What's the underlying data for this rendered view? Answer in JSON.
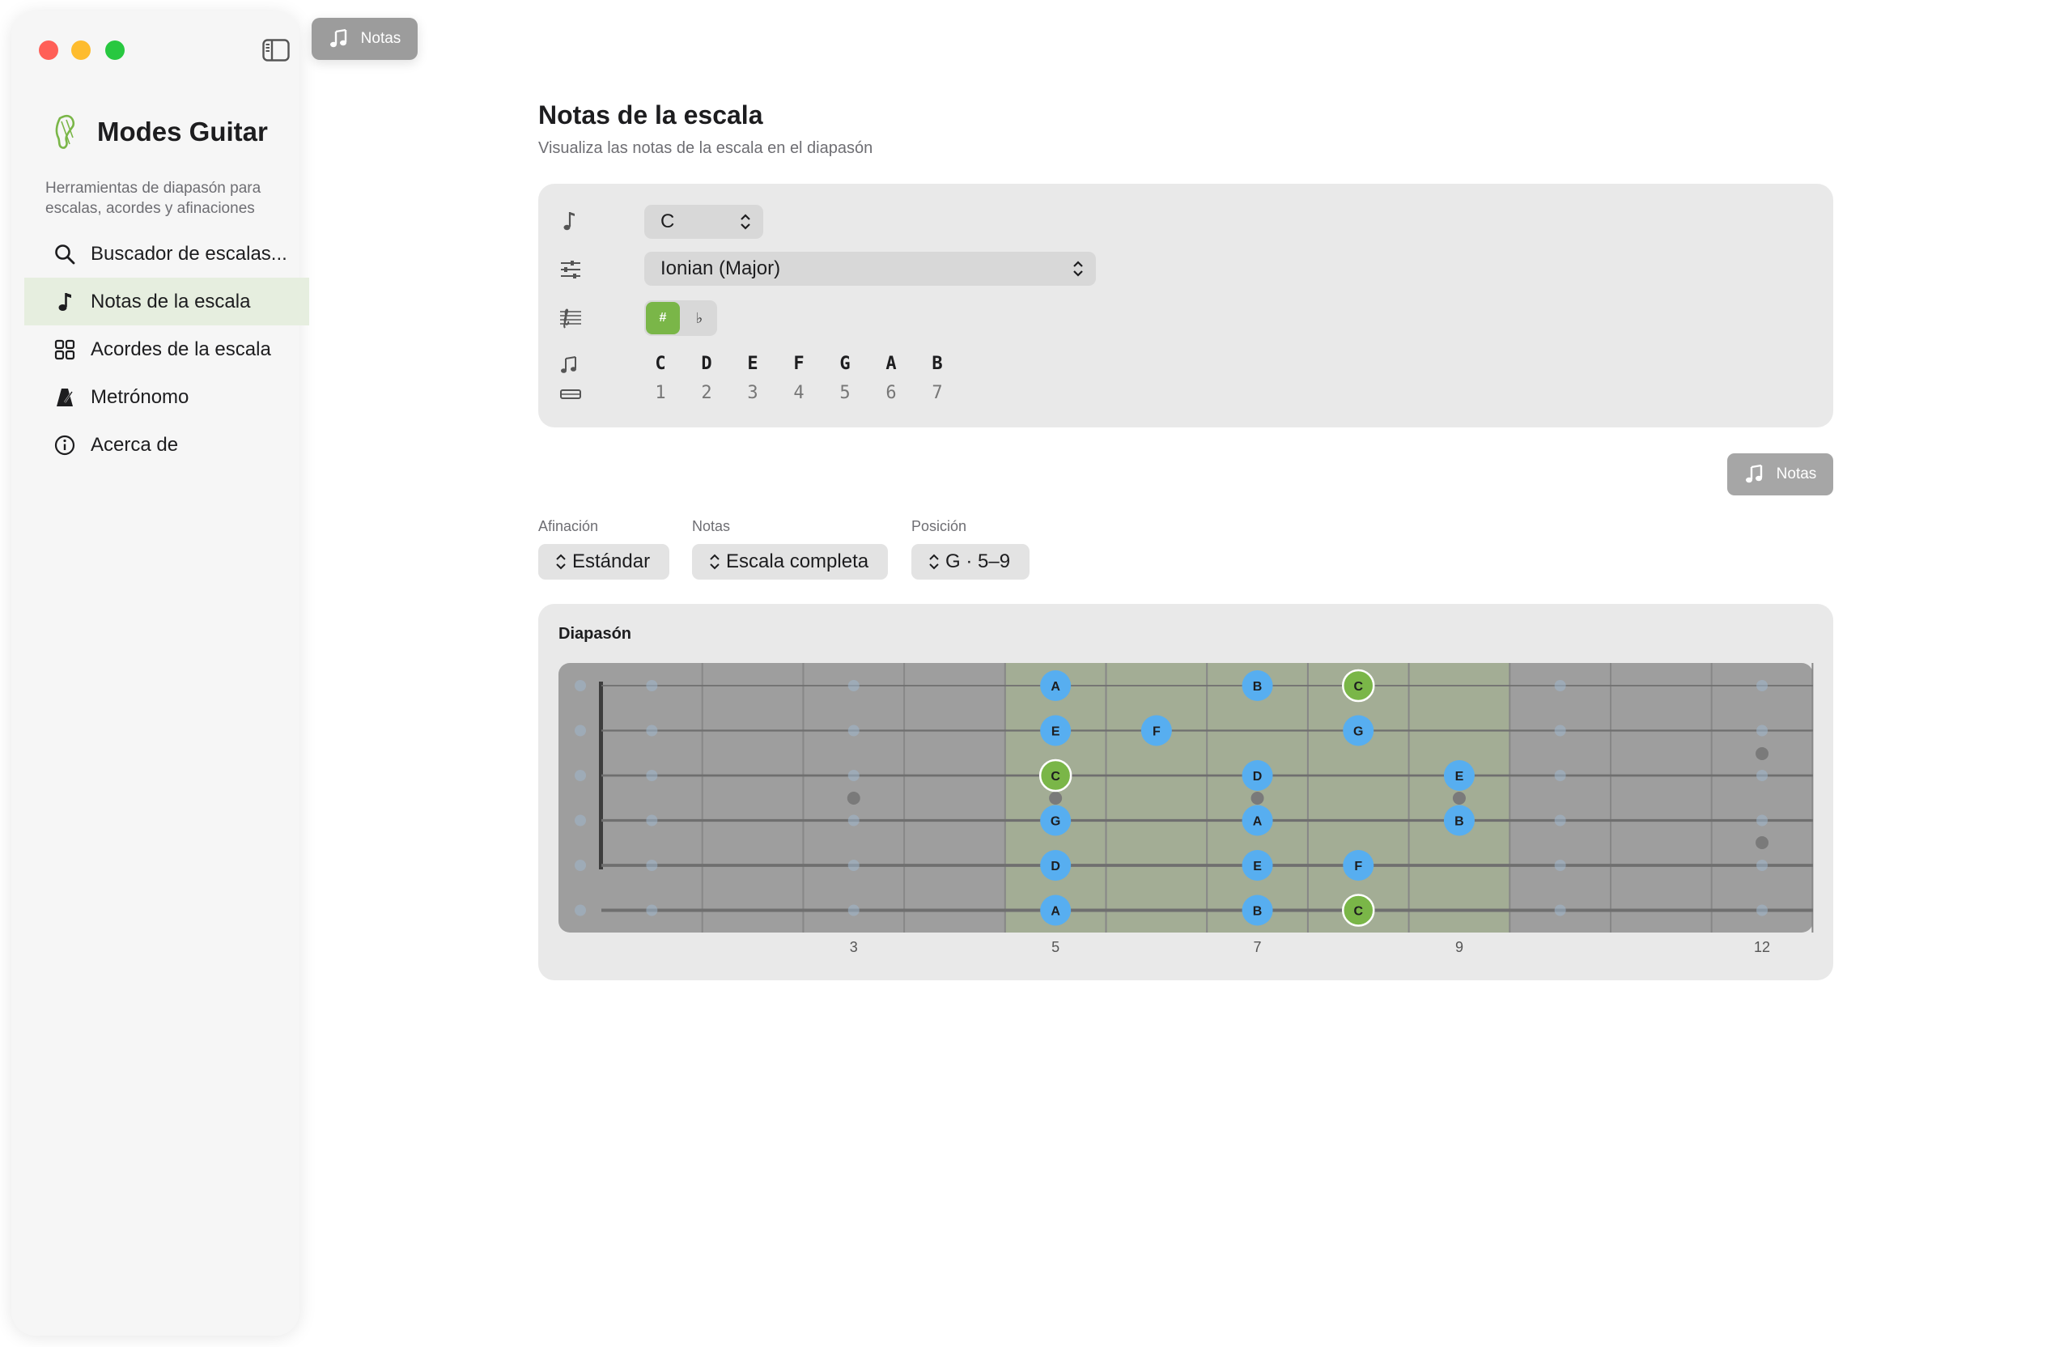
{
  "window": {
    "titlebar_button": {
      "label": "Notas",
      "icon": "music-notes-icon"
    }
  },
  "sidebar": {
    "app_name": "Modes Guitar",
    "tagline": "Herramientas de diapasón para escalas, acordes y afinaciones",
    "items": [
      {
        "label": "Buscador de escalas...",
        "icon": "search-icon",
        "active": false
      },
      {
        "label": "Notas de la escala",
        "icon": "music-note-icon",
        "active": true
      },
      {
        "label": "Acordes de la escala",
        "icon": "grid-icon",
        "active": false
      },
      {
        "label": "Metrónomo",
        "icon": "metronome-icon",
        "active": false
      },
      {
        "label": "Acerca de",
        "icon": "info-icon",
        "active": false
      }
    ]
  },
  "main": {
    "title": "Notas de la escala",
    "subtitle": "Visualiza las notas de la escala en el diapasón",
    "controls": {
      "root": "C",
      "mode": "Ionian (Major)",
      "accidentals": {
        "sharp": "#",
        "flat": "♭",
        "selected": "sharp"
      },
      "scale_notes": [
        "C",
        "D",
        "E",
        "F",
        "G",
        "A",
        "B"
      ],
      "degrees": [
        "1",
        "2",
        "3",
        "4",
        "5",
        "6",
        "7"
      ]
    },
    "notas_button": "Notas",
    "filters": [
      {
        "label": "Afinación",
        "value": "Estándar"
      },
      {
        "label": "Notas",
        "value": "Escala completa"
      },
      {
        "label": "Posición",
        "value": "G · 5–9"
      }
    ],
    "fretboard": {
      "title": "Diapasón",
      "fret_labels": [
        {
          "fret": 3,
          "label": "3"
        },
        {
          "fret": 5,
          "label": "5"
        },
        {
          "fret": 7,
          "label": "7"
        },
        {
          "fret": 9,
          "label": "9"
        },
        {
          "fret": 12,
          "label": "12"
        }
      ],
      "position_range": [
        5,
        9
      ],
      "colors": {
        "board": "#9e9e9e",
        "highlight": "#a3ad95",
        "scale_note": "#57aef0",
        "root_note": "#7ab648"
      },
      "notes": [
        {
          "string": 1,
          "fret": 5,
          "note": "A",
          "root": false
        },
        {
          "string": 1,
          "fret": 7,
          "note": "B",
          "root": false
        },
        {
          "string": 1,
          "fret": 8,
          "note": "C",
          "root": true
        },
        {
          "string": 2,
          "fret": 5,
          "note": "E",
          "root": false
        },
        {
          "string": 2,
          "fret": 6,
          "note": "F",
          "root": false
        },
        {
          "string": 2,
          "fret": 8,
          "note": "G",
          "root": false
        },
        {
          "string": 3,
          "fret": 5,
          "note": "C",
          "root": true
        },
        {
          "string": 3,
          "fret": 7,
          "note": "D",
          "root": false
        },
        {
          "string": 3,
          "fret": 9,
          "note": "E",
          "root": false
        },
        {
          "string": 4,
          "fret": 5,
          "note": "G",
          "root": false
        },
        {
          "string": 4,
          "fret": 7,
          "note": "A",
          "root": false
        },
        {
          "string": 4,
          "fret": 9,
          "note": "B",
          "root": false
        },
        {
          "string": 5,
          "fret": 5,
          "note": "D",
          "root": false
        },
        {
          "string": 5,
          "fret": 7,
          "note": "E",
          "root": false
        },
        {
          "string": 5,
          "fret": 8,
          "note": "F",
          "root": false
        },
        {
          "string": 6,
          "fret": 5,
          "note": "A",
          "root": false
        },
        {
          "string": 6,
          "fret": 7,
          "note": "B",
          "root": false
        },
        {
          "string": 6,
          "fret": 8,
          "note": "C",
          "root": true
        }
      ]
    }
  }
}
